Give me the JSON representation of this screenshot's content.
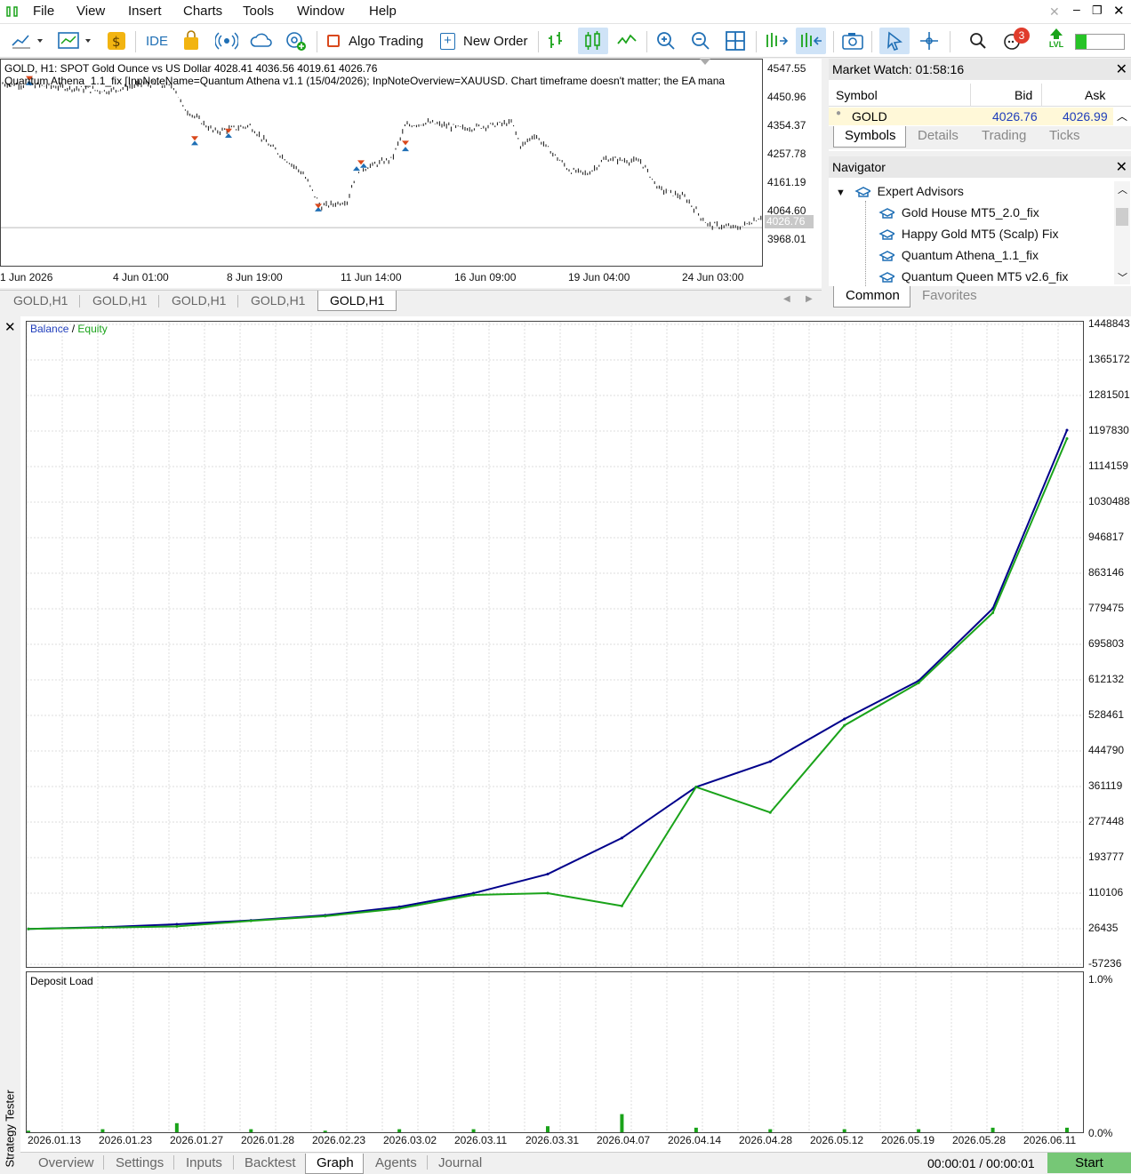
{
  "menu": [
    "File",
    "View",
    "Insert",
    "Charts",
    "Tools",
    "Window",
    "Help"
  ],
  "toolbar": {
    "ide": "IDE",
    "algo_trading": "Algo Trading",
    "new_order": "New Order",
    "notifications": "3",
    "lvl": "LVL"
  },
  "chart": {
    "header": "GOLD, H1:  SPOT Gold Ounce vs US Dollar  4028.41 4036.56 4019.61 4026.76",
    "ea_line": "Quantum Athena_1.1_fix [InpNoteName=Quantum Athena v1.1 (15/04/2026); InpNoteOverview=XAUUSD. Chart timeframe doesn't matter; the EA mana",
    "price_labels": [
      "4547.55",
      "4450.96",
      "4354.37",
      "4257.78",
      "4161.19",
      "4064.60",
      "3968.01"
    ],
    "current_price": "4026.76",
    "time_labels": [
      "1 Jun 2026",
      "4 Jun 01:00",
      "8 Jun 19:00",
      "11 Jun 14:00",
      "16 Jun 09:00",
      "19 Jun 04:00",
      "24 Jun 03:00"
    ],
    "tabs": [
      "GOLD,H1",
      "GOLD,H1",
      "GOLD,H1",
      "GOLD,H1",
      "GOLD,H1"
    ]
  },
  "market_watch": {
    "title": "Market Watch: 01:58:16",
    "columns": [
      "Symbol",
      "Bid",
      "Ask"
    ],
    "row": {
      "symbol": "GOLD",
      "bid": "4026.76",
      "ask": "4026.99"
    },
    "tabs": [
      "Symbols",
      "Details",
      "Trading",
      "Ticks"
    ]
  },
  "navigator": {
    "title": "Navigator",
    "root": "Expert Advisors",
    "items": [
      "Gold House MT5_2.0_fix",
      "Happy Gold MT5 (Scalp) Fix",
      "Quantum Athena_1.1_fix",
      "Quantum Queen MT5 v2.6_fix"
    ],
    "tabs": [
      "Common",
      "Favorites"
    ]
  },
  "tester": {
    "side_label": "Strategy Tester",
    "legend_balance": "Balance",
    "legend_sep": "/",
    "legend_equity": "Equity",
    "load_title": "Deposit Load",
    "y_labels": [
      "1448843",
      "1365172",
      "1281501",
      "1197830",
      "1114159",
      "1030488",
      "946817",
      "863146",
      "779475",
      "695803",
      "612132",
      "528461",
      "444790",
      "361119",
      "277448",
      "193777",
      "110106",
      "26435",
      "-57236"
    ],
    "load_labels": [
      "1.0%",
      "0.0%"
    ],
    "x_labels": [
      "2026.01.13",
      "2026.01.23",
      "2026.01.27",
      "2026.01.28",
      "2026.02.23",
      "2026.03.02",
      "2026.03.11",
      "2026.03.31",
      "2026.04.07",
      "2026.04.14",
      "2026.04.28",
      "2026.05.12",
      "2026.05.19",
      "2026.05.28",
      "2026.06.11"
    ],
    "tabs": [
      "Overview",
      "Settings",
      "Inputs",
      "Backtest",
      "Graph",
      "Agents",
      "Journal"
    ],
    "timer": "00:00:01 / 00:00:01",
    "start": "Start"
  },
  "colors": {
    "balance": "#00008b",
    "equity": "#1aa31a",
    "buy_arrow": "#1f6fb5",
    "sell_arrow": "#d9481c",
    "start_btn": "#76c776"
  },
  "chart_data": [
    {
      "type": "line",
      "title": "Balance / Equity",
      "ylim": [
        -57236,
        1448843
      ],
      "x": [
        "2026.01.13",
        "2026.01.23",
        "2026.01.27",
        "2026.01.28",
        "2026.02.23",
        "2026.03.02",
        "2026.03.11",
        "2026.03.31",
        "2026.04.07",
        "2026.04.14",
        "2026.04.28",
        "2026.05.12",
        "2026.05.19",
        "2026.05.28",
        "2026.06.11"
      ],
      "series": [
        {
          "name": "Balance",
          "values": [
            26000,
            30000,
            37000,
            46000,
            58000,
            78000,
            110000,
            155000,
            240000,
            360000,
            420000,
            520000,
            610000,
            780000,
            1200000
          ]
        },
        {
          "name": "Equity",
          "values": [
            26000,
            29000,
            32000,
            45000,
            56000,
            74000,
            106000,
            110000,
            80000,
            360000,
            300000,
            505000,
            605000,
            770000,
            1180000
          ]
        }
      ]
    },
    {
      "type": "bar",
      "title": "Deposit Load",
      "ylim": [
        0,
        1.0
      ],
      "categories": [
        "2026.01.13",
        "2026.01.23",
        "2026.01.27",
        "2026.01.28",
        "2026.02.23",
        "2026.03.02",
        "2026.03.11",
        "2026.03.31",
        "2026.04.07",
        "2026.04.14",
        "2026.04.28",
        "2026.05.12",
        "2026.05.19",
        "2026.05.28",
        "2026.06.11"
      ],
      "values": [
        0.01,
        0.02,
        0.06,
        0.02,
        0.01,
        0.02,
        0.02,
        0.04,
        0.12,
        0.03,
        0.02,
        0.02,
        0.02,
        0.03,
        0.03
      ]
    }
  ]
}
